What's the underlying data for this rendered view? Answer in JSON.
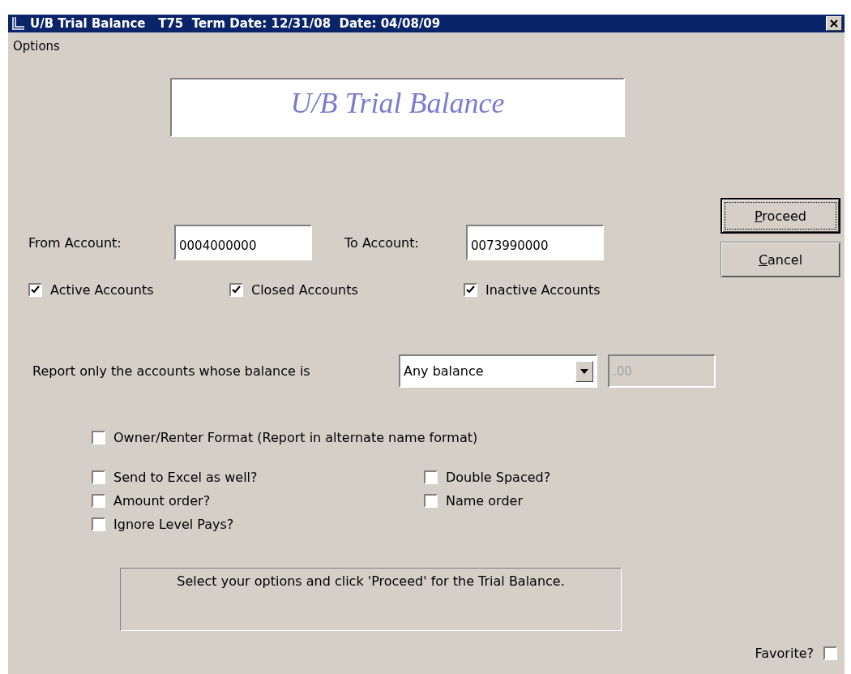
{
  "window": {
    "title": "U/B Trial Balance   T75  Term Date: 12/31/08  Date: 04/08/09"
  },
  "menu": [
    "Options"
  ],
  "banner": "U/B Trial Balance",
  "from_account": {
    "label": "From Account:",
    "value": "0004000000"
  },
  "to_account": {
    "label": "To Account:",
    "value": "0073990000"
  },
  "buttons": [
    {
      "label": "Proceed",
      "default": true
    },
    {
      "label": "Cancel",
      "default": false
    }
  ],
  "account_types": [
    {
      "label": "Active Accounts",
      "checked": true
    },
    {
      "label": "Closed Accounts",
      "checked": true
    },
    {
      "label": "Inactive Accounts",
      "checked": true
    }
  ],
  "balance_filter": {
    "label": "Report only the accounts whose balance is",
    "value": "Any balance",
    "amount": ".00",
    "amount_disabled": true
  },
  "owner_renter": {
    "label": "Owner/Renter Format (Report in alternate name format)",
    "checked": false
  },
  "options": [
    {
      "label": "Send to Excel as well?",
      "checked": false
    },
    {
      "label": "Double Spaced?",
      "checked": false
    },
    {
      "label": "Amount order?",
      "checked": false
    },
    {
      "label": "Name order",
      "checked": false
    },
    {
      "label": "Ignore Level Pays?",
      "checked": false
    }
  ],
  "status": "Select your options and click 'Proceed' for the Trial Balance.",
  "favorite": {
    "label": "Favorite?",
    "checked": false
  }
}
